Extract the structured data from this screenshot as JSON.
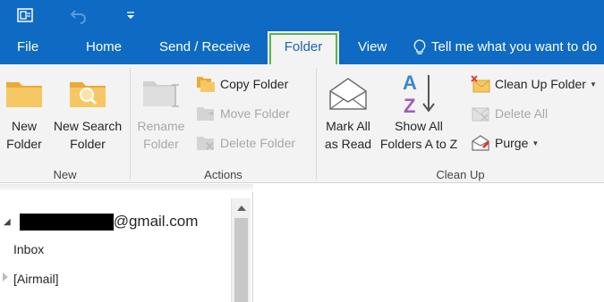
{
  "titlebar": {
    "background": "#0f6ac3",
    "icons": [
      "outlook-app-icon",
      "undo-icon",
      "customize-quick-access-icon"
    ]
  },
  "tabs": {
    "file": "File",
    "home": "Home",
    "send_receive": "Send / Receive",
    "folder": "Folder",
    "view": "View",
    "active": "Folder",
    "tell_me": "Tell me what you want to do"
  },
  "ribbon": {
    "groups": {
      "new": {
        "label": "New",
        "new_folder": [
          "New",
          "Folder"
        ],
        "new_search_folder": [
          "New Search",
          "Folder"
        ]
      },
      "actions": {
        "label": "Actions",
        "rename_folder": [
          "Rename",
          "Folder"
        ],
        "copy_folder": "Copy Folder",
        "move_folder": "Move Folder",
        "delete_folder": "Delete Folder"
      },
      "clean_up": {
        "label": "Clean Up",
        "mark_all_as_read": [
          "Mark All",
          "as Read"
        ],
        "show_all_folders": [
          "Show All",
          "Folders A to Z"
        ],
        "clean_up_folder": "Clean Up Folder",
        "delete_all": "Delete All",
        "purge": "Purge"
      }
    },
    "disabled_color": "#a8a8a8",
    "accent_folder": "#f0c15c"
  },
  "folder_pane": {
    "account_suffix": "@gmail.com",
    "items": [
      "Inbox",
      "[Airmail]"
    ]
  }
}
